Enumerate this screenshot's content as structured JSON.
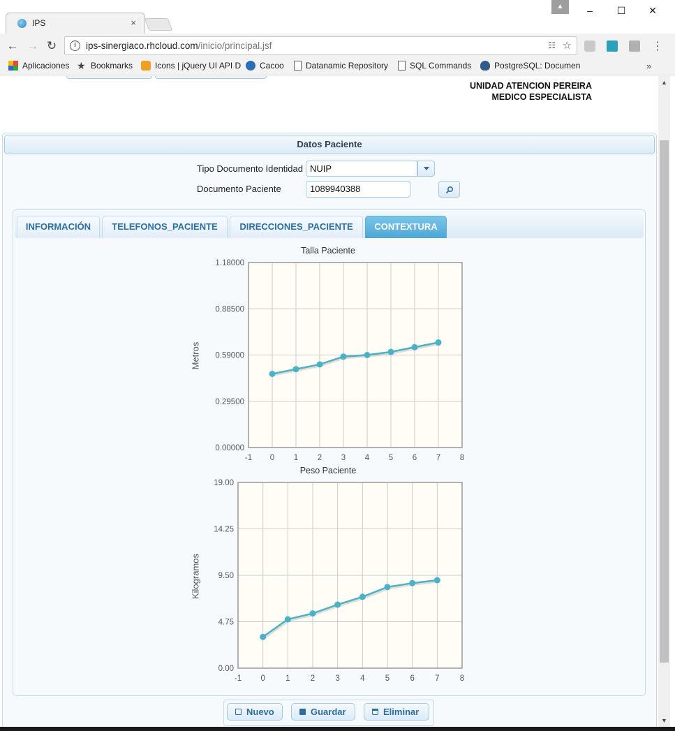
{
  "browser": {
    "tab_title": "IPS",
    "url_host": "ips-sinergiaco.rhcloud.com",
    "url_path": "/inicio/principal.jsf",
    "bookmarks": [
      {
        "label": "Aplicaciones",
        "icon": "apps-grid-icon"
      },
      {
        "label": "Bookmarks",
        "icon": "star-icon"
      },
      {
        "label": "Icons | jQuery UI API D",
        "icon": "jquery-icon"
      },
      {
        "label": "Cacoo",
        "icon": "cacoo-icon"
      },
      {
        "label": "Datanamic Repository",
        "icon": "document-icon"
      },
      {
        "label": "SQL Commands",
        "icon": "document-icon"
      },
      {
        "label": "PostgreSQL: Documen",
        "icon": "postgres-icon"
      }
    ],
    "bookmarks_more": "»"
  },
  "header": {
    "line1": "UNIDAD ATENCION PEREIRA",
    "line2": "MEDICO ESPECIALISTA"
  },
  "panel": {
    "title": "Datos Paciente",
    "tipo_doc_label": "Tipo Documento Identidad",
    "tipo_doc_value": "NUIP",
    "doc_label": "Documento Paciente",
    "doc_value": "1089940388"
  },
  "tabs": [
    {
      "label": "INFORMACIÓN",
      "active": false
    },
    {
      "label": "TELEFONOS_PACIENTE",
      "active": false
    },
    {
      "label": "DIRECCIONES_PACIENTE",
      "active": false
    },
    {
      "label": "CONTEXTURA",
      "active": true
    }
  ],
  "chart_data": [
    {
      "type": "line",
      "title": "Talla Paciente",
      "xlabel": "",
      "ylabel": "Metros",
      "x": [
        0,
        1,
        2,
        3,
        4,
        5,
        6,
        7
      ],
      "y": [
        0.47,
        0.5,
        0.53,
        0.58,
        0.59,
        0.61,
        0.64,
        0.67
      ],
      "xlim": [
        -1,
        8
      ],
      "ylim": [
        0,
        1.18
      ],
      "xticks": [
        "-1",
        "0",
        "1",
        "2",
        "3",
        "4",
        "5",
        "6",
        "7",
        "8"
      ],
      "yticks": [
        "0.00000",
        "0.29500",
        "0.59000",
        "0.88500",
        "1.18000"
      ],
      "grid": true,
      "color": "#4bb2c5"
    },
    {
      "type": "line",
      "title": "Peso Paciente",
      "xlabel": "",
      "ylabel": "Kilogramos",
      "x": [
        0,
        1,
        2,
        3,
        4,
        5,
        6,
        7
      ],
      "y": [
        3.2,
        5.0,
        5.6,
        6.5,
        7.3,
        8.3,
        8.7,
        9.0
      ],
      "xlim": [
        -1,
        8
      ],
      "ylim": [
        0,
        19
      ],
      "xticks": [
        "-1",
        "0",
        "1",
        "2",
        "3",
        "4",
        "5",
        "6",
        "7",
        "8"
      ],
      "yticks": [
        "0.00",
        "4.75",
        "9.50",
        "14.25",
        "19.00"
      ],
      "grid": true,
      "color": "#4bb2c5"
    }
  ],
  "actions": {
    "nuevo": "Nuevo",
    "guardar": "Guardar",
    "eliminar": "Eliminar"
  }
}
